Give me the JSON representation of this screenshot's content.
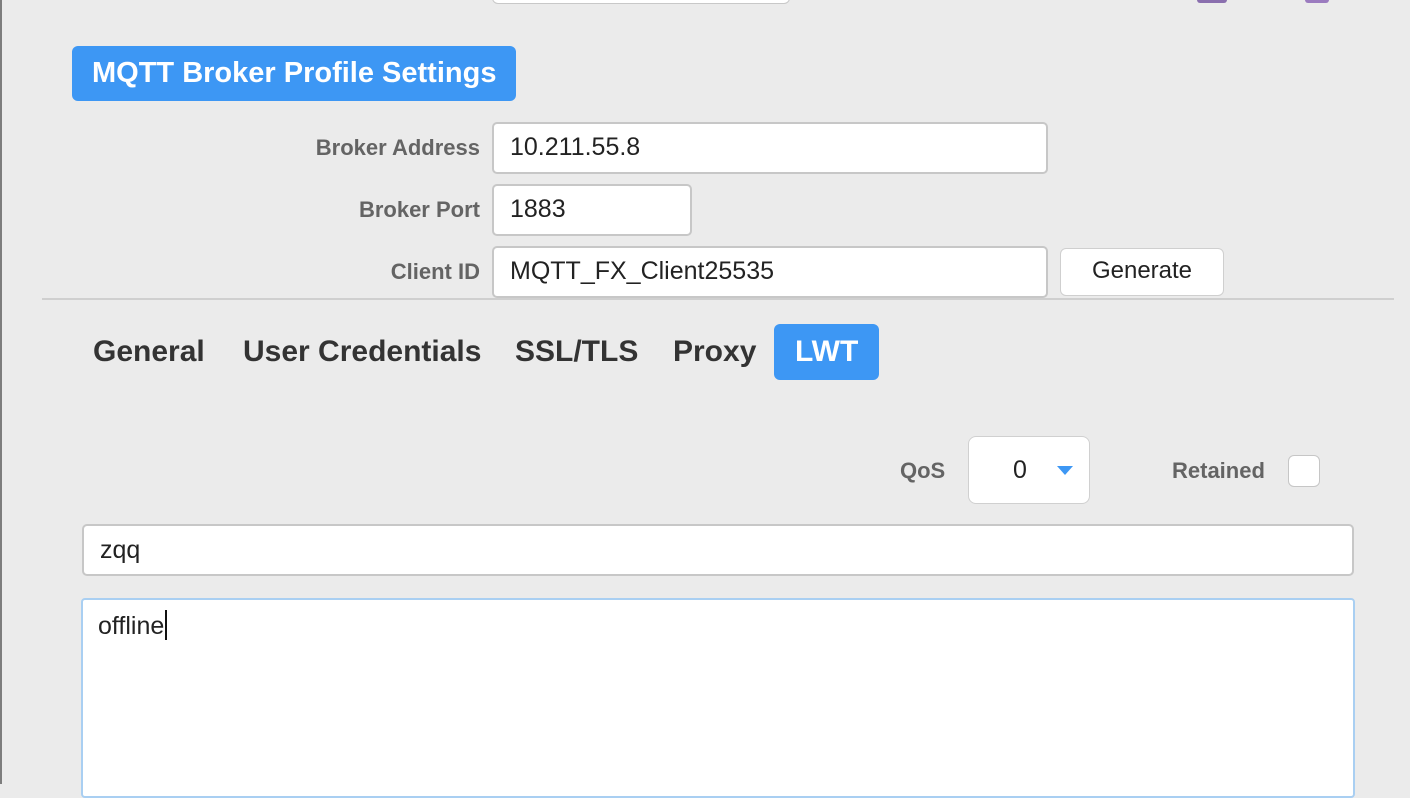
{
  "header": {
    "section_title": "MQTT Broker Profile Settings"
  },
  "broker": {
    "address_label": "Broker Address",
    "address_value": "10.211.55.8",
    "port_label": "Broker Port",
    "port_value": "1883",
    "client_id_label": "Client ID",
    "client_id_value": "MQTT_FX_Client25535",
    "generate_label": "Generate"
  },
  "tabs": [
    {
      "label": "General",
      "active": false
    },
    {
      "label": "User Credentials",
      "active": false
    },
    {
      "label": "SSL/TLS",
      "active": false
    },
    {
      "label": "Proxy",
      "active": false
    },
    {
      "label": "LWT",
      "active": true
    }
  ],
  "lwt": {
    "qos_label": "QoS",
    "qos_value": "0",
    "retained_label": "Retained",
    "retained_checked": false,
    "topic_value": "zqq",
    "message_value": "offline"
  },
  "colors": {
    "accent": "#3d97f4",
    "background": "#ebebeb"
  },
  "icons": {
    "qos_dropdown": "triangle-down-icon"
  }
}
